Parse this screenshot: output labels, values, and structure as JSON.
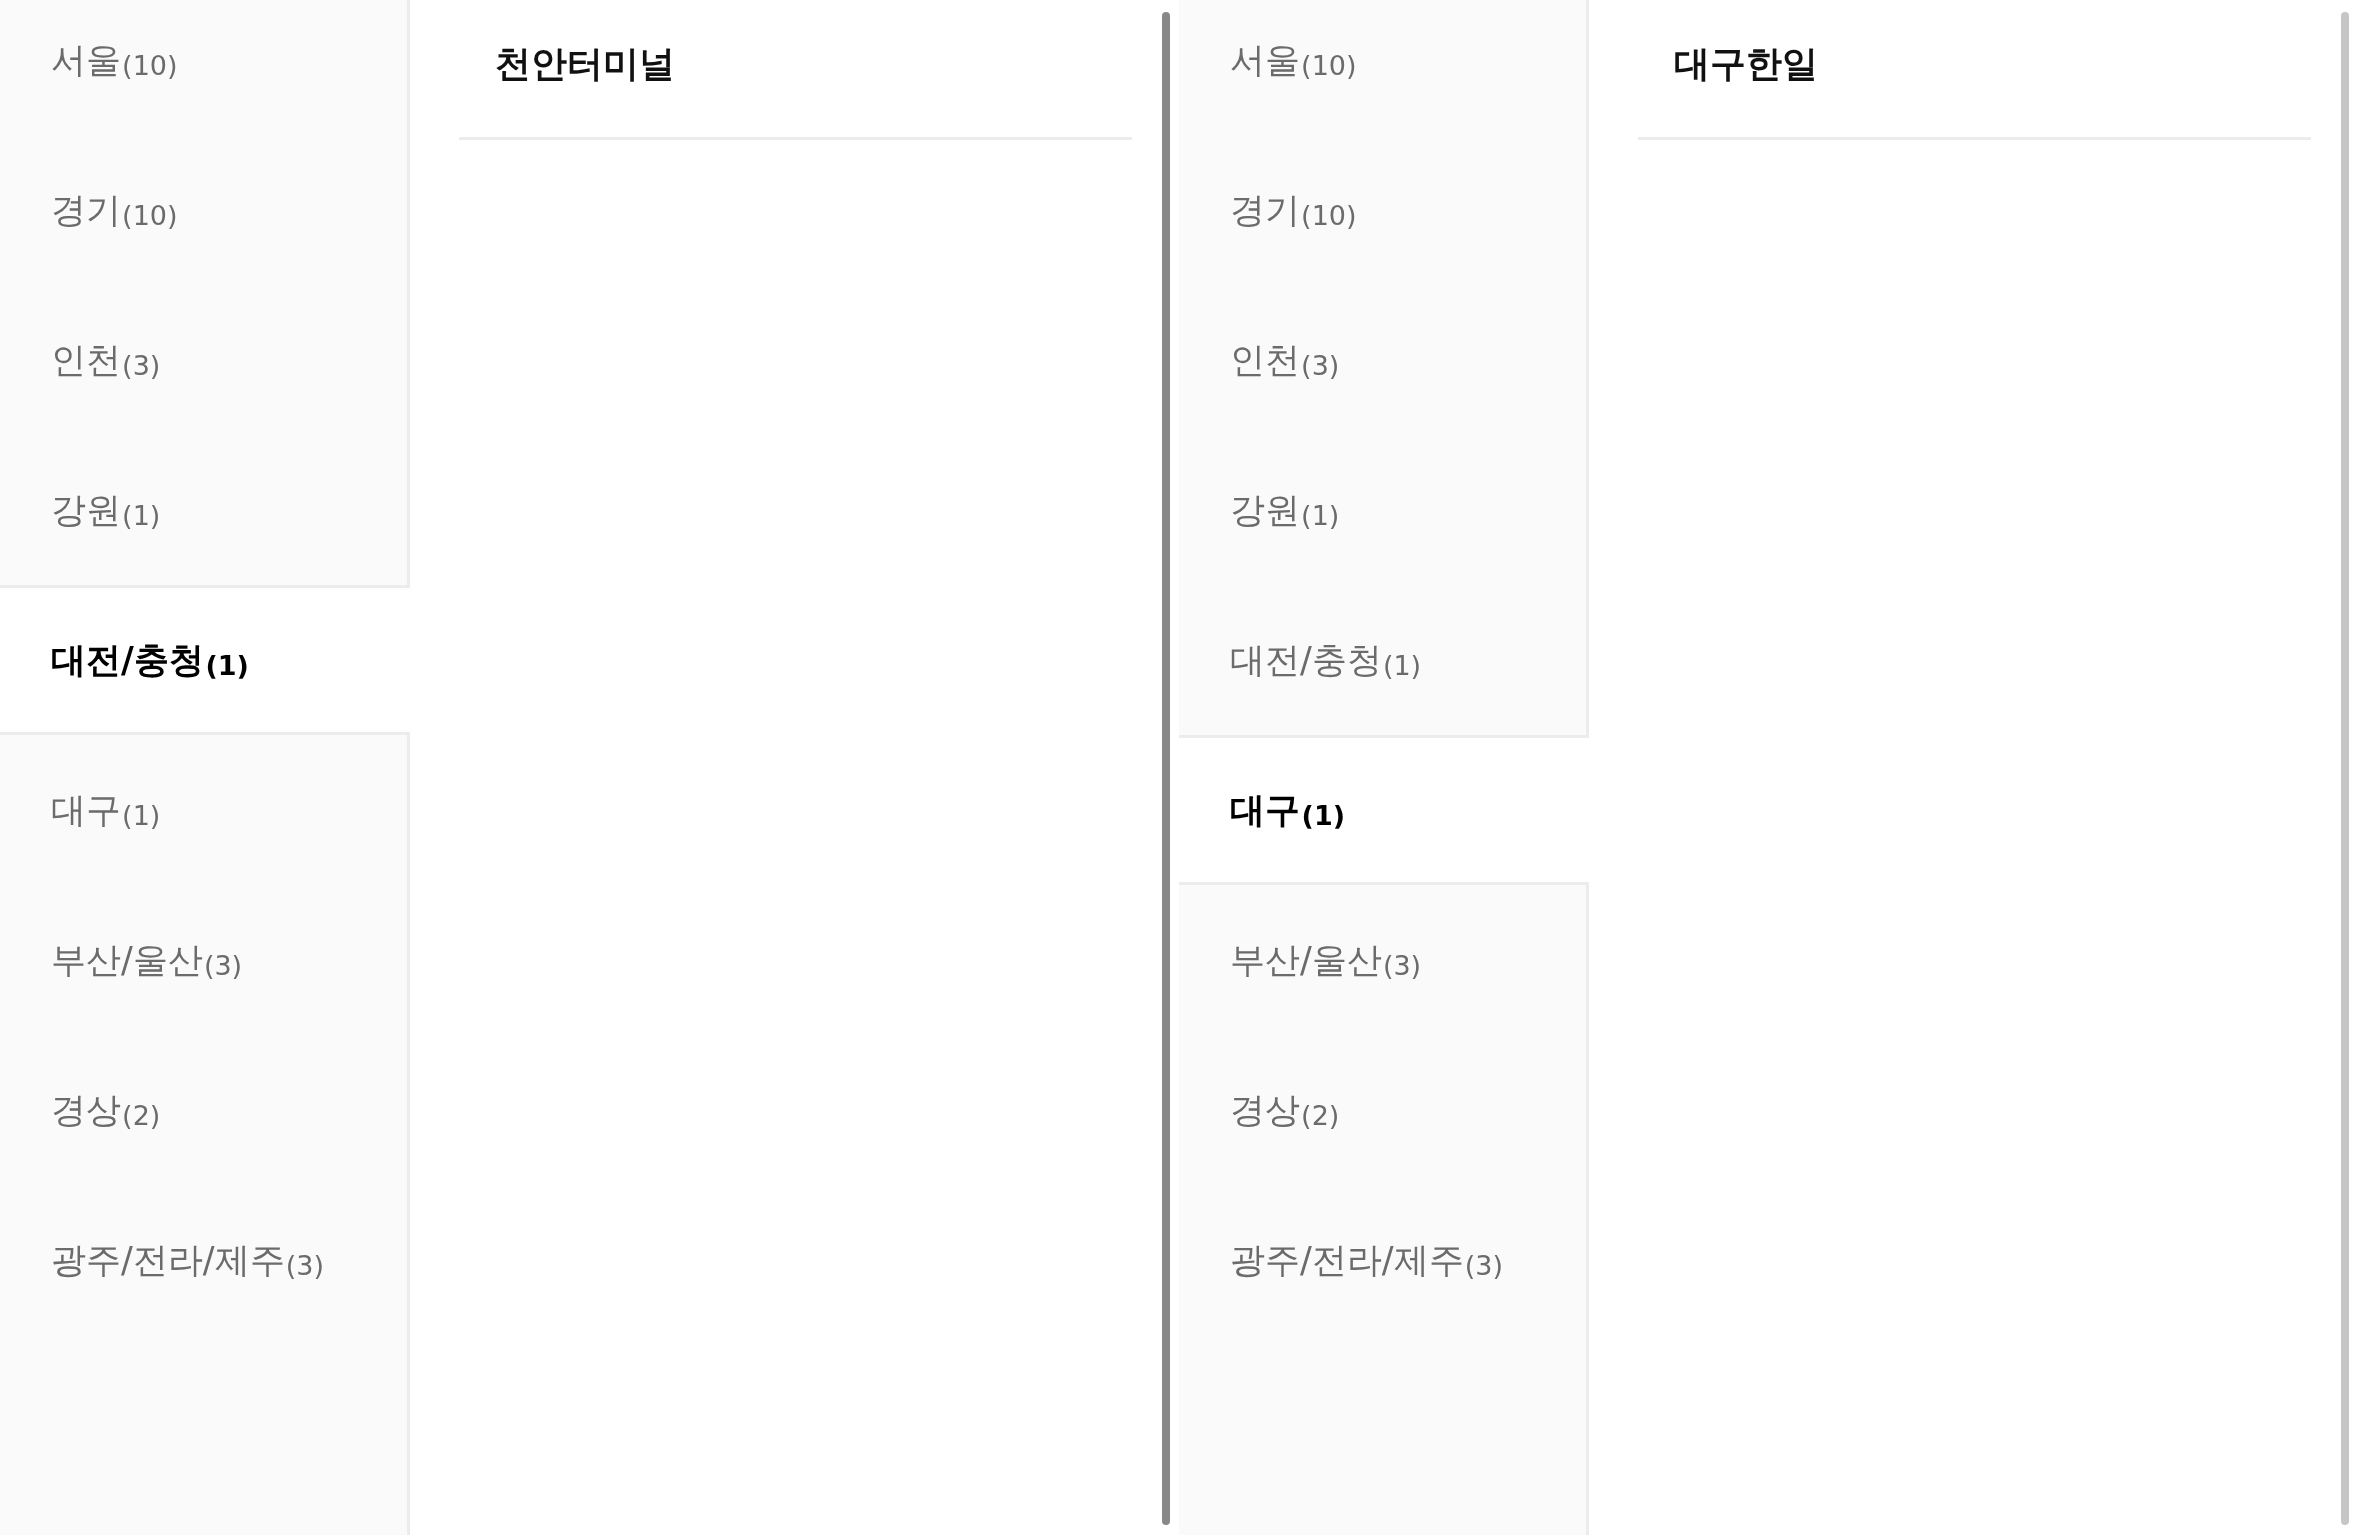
{
  "panes": [
    {
      "regions": [
        {
          "name": "서울",
          "count": "(10)",
          "selected": false
        },
        {
          "name": "경기",
          "count": "(10)",
          "selected": false
        },
        {
          "name": "인천",
          "count": "(3)",
          "selected": false
        },
        {
          "name": "강원",
          "count": "(1)",
          "selected": false
        },
        {
          "name": "대전/충청",
          "count": "(1)",
          "selected": true
        },
        {
          "name": "대구",
          "count": "(1)",
          "selected": false
        },
        {
          "name": "부산/울산",
          "count": "(3)",
          "selected": false
        },
        {
          "name": "경상",
          "count": "(2)",
          "selected": false
        },
        {
          "name": "광주/전라/제주",
          "count": "(3)",
          "selected": false
        }
      ],
      "title": "천안터미널",
      "scrollbar_active": true
    },
    {
      "regions": [
        {
          "name": "서울",
          "count": "(10)",
          "selected": false
        },
        {
          "name": "경기",
          "count": "(10)",
          "selected": false
        },
        {
          "name": "인천",
          "count": "(3)",
          "selected": false
        },
        {
          "name": "강원",
          "count": "(1)",
          "selected": false
        },
        {
          "name": "대전/충청",
          "count": "(1)",
          "selected": false
        },
        {
          "name": "대구",
          "count": "(1)",
          "selected": true
        },
        {
          "name": "부산/울산",
          "count": "(3)",
          "selected": false
        },
        {
          "name": "경상",
          "count": "(2)",
          "selected": false
        },
        {
          "name": "광주/전라/제주",
          "count": "(3)",
          "selected": false
        }
      ],
      "title": "대구한일",
      "scrollbar_active": false
    }
  ]
}
